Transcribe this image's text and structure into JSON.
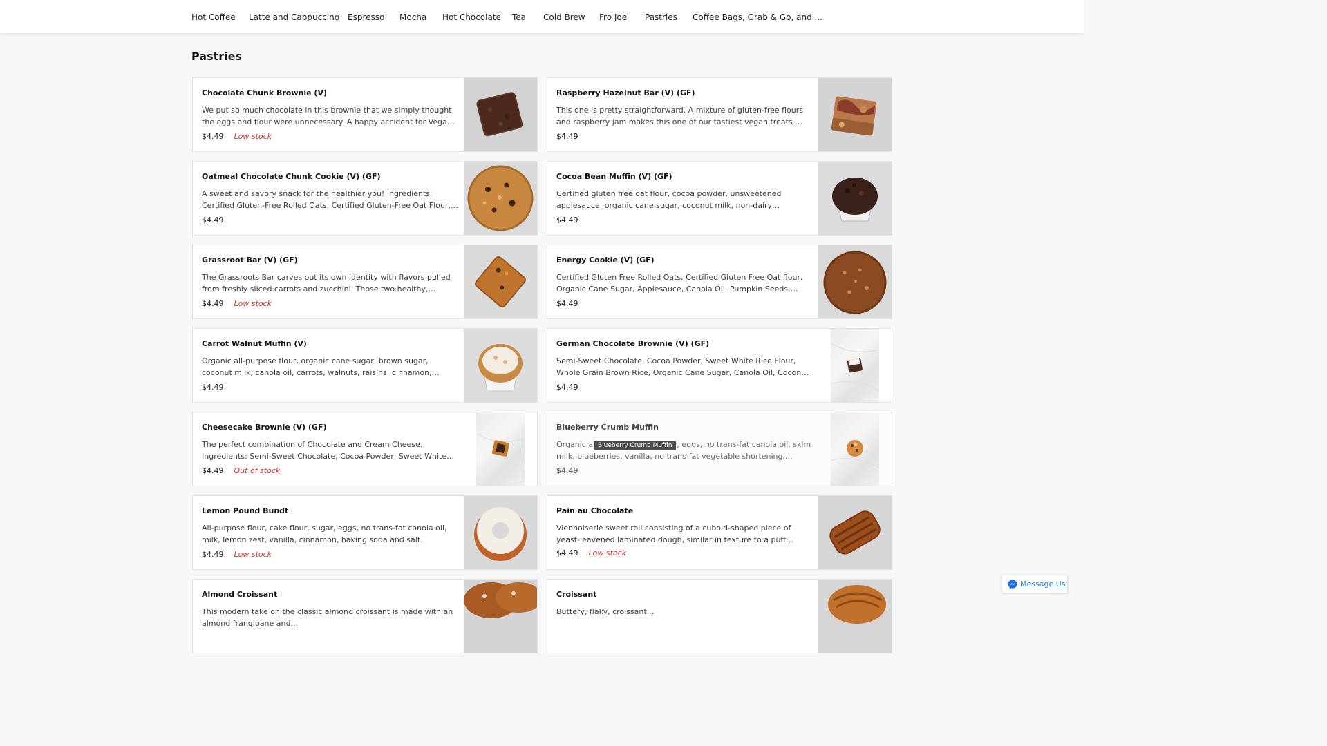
{
  "nav": {
    "categories": [
      "Hot Coffee",
      "Latte and Cappuccino",
      "Espresso",
      "Mocha",
      "Hot Chocolate",
      "Tea",
      "Cold Brew",
      "Fro Joe",
      "Pastries",
      "Coffee Bags, Grab & Go, and ..."
    ]
  },
  "section": {
    "title": "Pastries"
  },
  "products": [
    {
      "name": "Chocolate Chunk Brownie (V)",
      "description": "We put so much chocolate in this brownie that we simply thought the eggs and flour were unnecessary. A happy accident for Vegans and...",
      "price": "$4.49",
      "stock": "Low stock",
      "image": "brownie"
    },
    {
      "name": "Raspberry Hazelnut Bar (V) (GF)",
      "description": "This one is pretty straightforward. A mixture of gluten-free flours and raspberry jam makes this one of our tastiest vegan treats. Ingredient...",
      "price": "$4.49",
      "stock": "",
      "image": "raspberry-bar"
    },
    {
      "name": "Oatmeal Chocolate Chunk Cookie (V) (GF)",
      "description": "A sweet and savory snack for the healthier you! Ingredients: Certified Gluten-Free Rolled Oats, Certified Gluten-Free Oat Flour, Organic...",
      "price": "$4.49",
      "stock": "",
      "image": "oatmeal-cookie"
    },
    {
      "name": "Cocoa Bean Muffin (V) (GF)",
      "description": "Certified gluten free oat flour, cocoa powder, unsweetened applesauce, organic cane sugar, coconut milk, non-dairy chocolate...",
      "price": "$4.49",
      "stock": "",
      "image": "cocoa-muffin"
    },
    {
      "name": "Grassroot Bar (V) (GF)",
      "description": "The Grassroots Bar carves out its own identity with flavors pulled from freshly sliced carrots and zucchini. Those two healthy, colorful...",
      "price": "$4.49",
      "stock": "Low stock",
      "image": "grassroot-bar"
    },
    {
      "name": "Energy Cookie (V) (GF)",
      "description": "Certified Gluten Free Rolled Oats, Certified Gluten Free Oat flour, Organic Cane Sugar, Applesauce, Canola Oil, Pumpkin Seeds, Dried...",
      "price": "$4.49",
      "stock": "",
      "image": "energy-cookie"
    },
    {
      "name": "Carrot Walnut Muffin (V)",
      "description": "Organic all-purpose flour, organic cane sugar, brown sugar, coconut milk, canola oil, carrots, walnuts, raisins, cinnamon, molasses, salt,...",
      "price": "$4.49",
      "stock": "",
      "image": "carrot-muffin"
    },
    {
      "name": "German Chocolate Brownie (V) (GF)",
      "description": "Semi-Sweet Chocolate, Cocoa Powder, Sweet White Rice Flour, Whole Grain Brown Rice, Organic Cane Sugar, Canola Oil, Coconut Milk,...",
      "price": "$4.49",
      "stock": "",
      "image": "german-brownie"
    },
    {
      "name": "Cheesecake Brownie (V) (GF)",
      "description": "The perfect combination of Chocolate and Cream Cheese. Ingredients: Semi-Sweet Chocolate, Cocoa Powder, Sweet White Ric...",
      "price": "$4.49",
      "stock": "Out of stock",
      "image": "cheesecake-brownie"
    },
    {
      "name": "Blueberry Crumb Muffin",
      "description": "Organic all-purpose flour, sugar, eggs, no trans-fat canola oil, skim milk, blueberries, vanilla, no trans-fat vegetable shortening,...",
      "price": "$4.49",
      "stock": "",
      "image": "blueberry-muffin"
    },
    {
      "name": "Lemon Pound Bundt",
      "description": "All-purpose flour, cake flour, sugar, eggs, no trans-fat canola oil, milk, lemon zest, vanilla, cinnamon, baking soda and salt.",
      "price": "$4.49",
      "stock": "Low stock",
      "image": "lemon-bundt"
    },
    {
      "name": "Pain au Chocolate",
      "description": "Viennoiserie sweet roll consisting of a cuboid-shaped piece of yeast-leavened laminated dough, similar in texture to a puff pastry, with on...",
      "price": "$4.49",
      "stock": "Low stock",
      "image": "pain-au-chocolat"
    },
    {
      "name": "Almond Croissant",
      "description": "This modern take on the classic almond croissant is made with an almond frangipane and...",
      "price": "",
      "stock": "",
      "image": "almond-croissant"
    },
    {
      "name": "Croissant",
      "description": "Buttery, flaky, croissant...",
      "price": "",
      "stock": "",
      "image": "croissant"
    }
  ],
  "tooltip": {
    "text": "Blueberry Crumb Muffin"
  },
  "message_button": {
    "label": "Message Us",
    "icon": "messenger-icon"
  },
  "colors": {
    "stock_warning": "#d6302b",
    "message_blue": "#1a73e8"
  }
}
